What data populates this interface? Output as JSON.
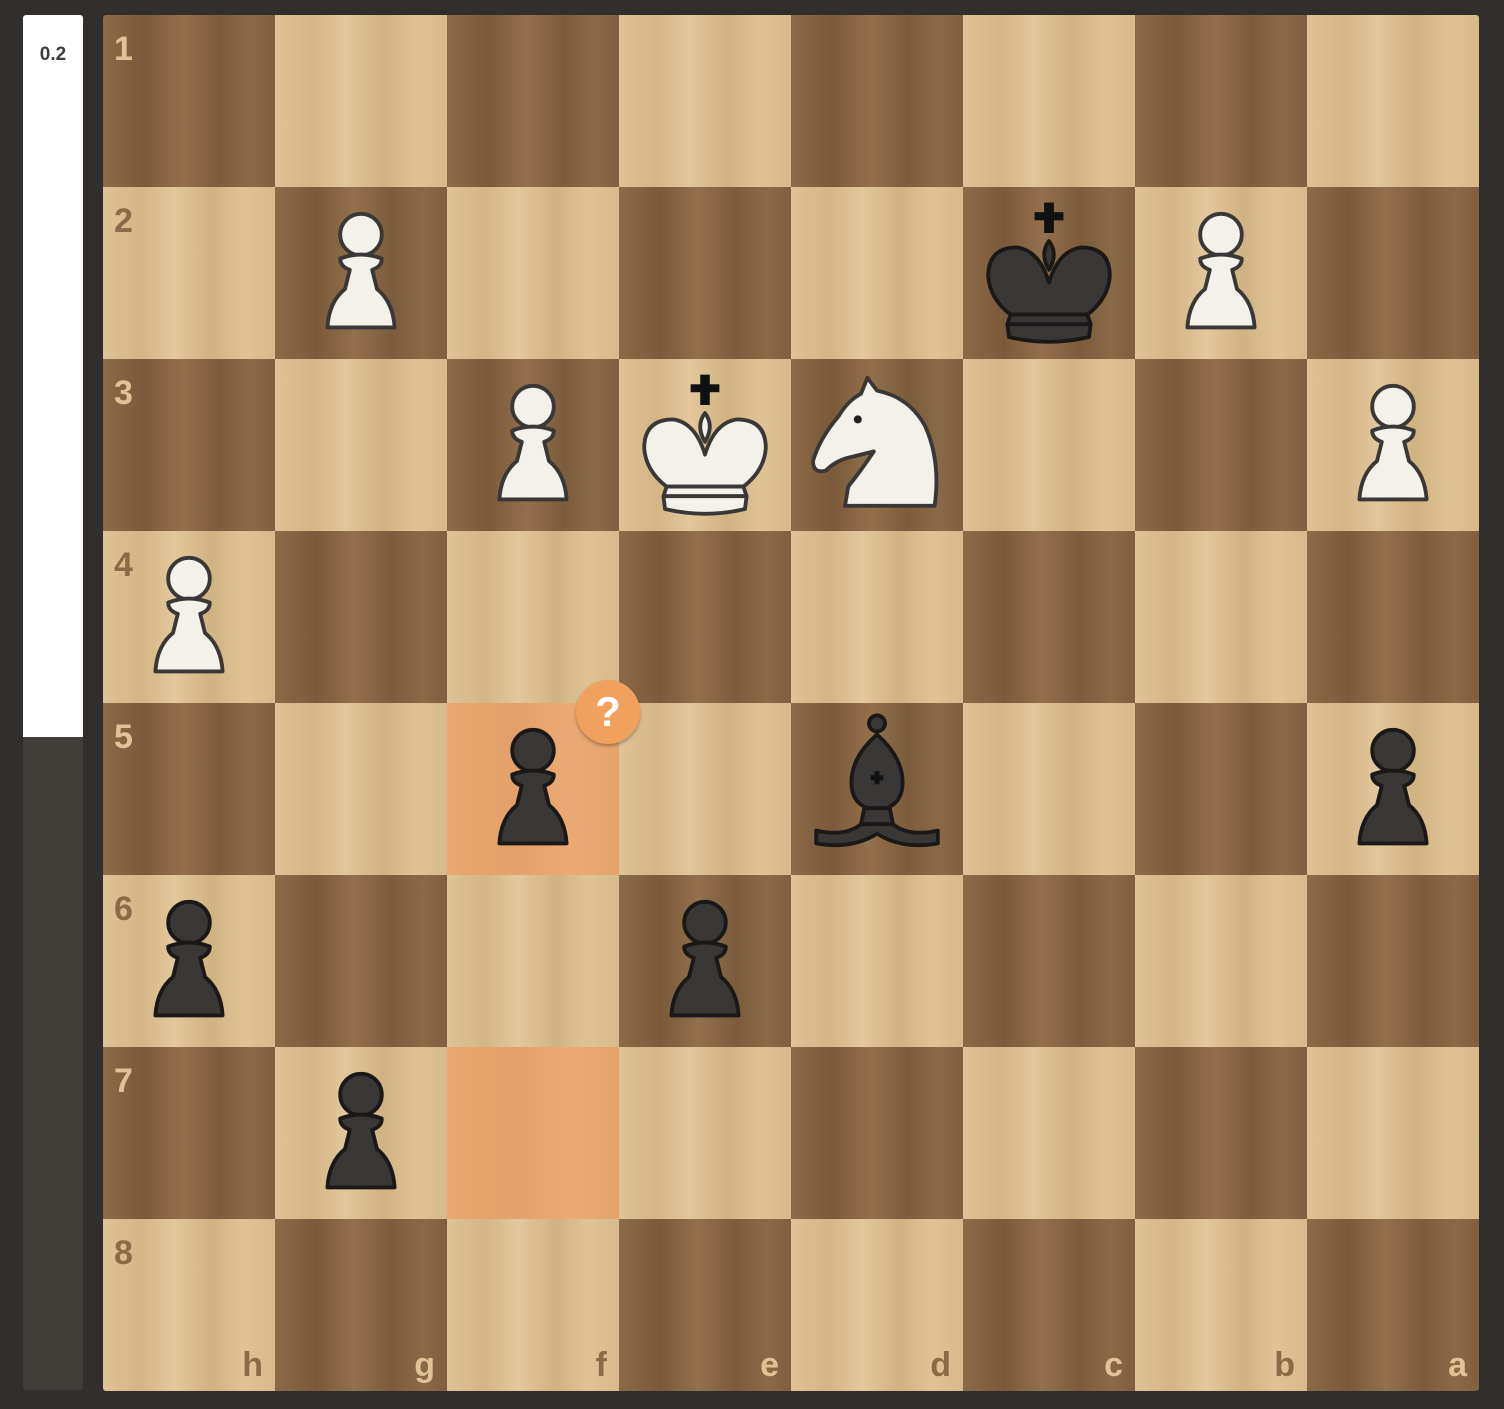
{
  "eval": {
    "label": "0.2",
    "white_fraction": 0.525
  },
  "board": {
    "orientation": "black",
    "rank_labels": [
      "1",
      "2",
      "3",
      "4",
      "5",
      "6",
      "7",
      "8"
    ],
    "file_labels": [
      "h",
      "g",
      "f",
      "e",
      "d",
      "c",
      "b",
      "a"
    ],
    "highlighted_squares": [
      "f5",
      "f7"
    ],
    "pieces": [
      {
        "square": "g2",
        "type": "pawn",
        "color": "white",
        "icon": "white-pawn-icon"
      },
      {
        "square": "c2",
        "type": "king",
        "color": "black",
        "icon": "black-king-icon"
      },
      {
        "square": "b2",
        "type": "pawn",
        "color": "white",
        "icon": "white-pawn-icon"
      },
      {
        "square": "f3",
        "type": "pawn",
        "color": "white",
        "icon": "white-pawn-icon"
      },
      {
        "square": "e3",
        "type": "king",
        "color": "white",
        "icon": "white-king-icon"
      },
      {
        "square": "d3",
        "type": "knight",
        "color": "white",
        "icon": "white-knight-icon"
      },
      {
        "square": "a3",
        "type": "pawn",
        "color": "white",
        "icon": "white-pawn-icon"
      },
      {
        "square": "h4",
        "type": "pawn",
        "color": "white",
        "icon": "white-pawn-icon"
      },
      {
        "square": "f5",
        "type": "pawn",
        "color": "black",
        "icon": "black-pawn-icon"
      },
      {
        "square": "d5",
        "type": "bishop",
        "color": "black",
        "icon": "black-bishop-icon"
      },
      {
        "square": "a5",
        "type": "pawn",
        "color": "black",
        "icon": "black-pawn-icon"
      },
      {
        "square": "h6",
        "type": "pawn",
        "color": "black",
        "icon": "black-pawn-icon"
      },
      {
        "square": "e6",
        "type": "pawn",
        "color": "black",
        "icon": "black-pawn-icon"
      },
      {
        "square": "g7",
        "type": "pawn",
        "color": "black",
        "icon": "black-pawn-icon"
      }
    ],
    "annotation": {
      "square": "f5",
      "symbol": "?",
      "icon": "mistake-icon",
      "color": "#f0a15e"
    }
  },
  "colors": {
    "light_square": "#dec396",
    "dark_square": "#8c6a47",
    "highlight": "#f3bc85",
    "background": "#312e2b"
  }
}
